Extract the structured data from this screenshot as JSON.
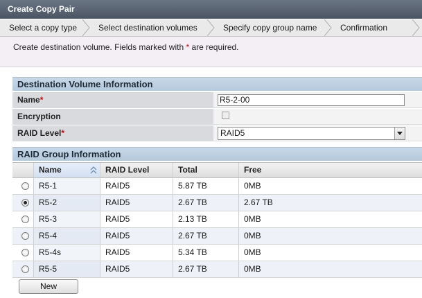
{
  "window": {
    "title": "Create Copy Pair"
  },
  "wizard": {
    "steps": [
      {
        "label": "Select a copy type"
      },
      {
        "label": "Select destination volumes"
      },
      {
        "label": "Specify copy group name"
      },
      {
        "label": "Confirmation"
      }
    ]
  },
  "info": {
    "text_before": "Create destination volume. Fields marked with ",
    "asterisk": "*",
    "text_after": " are required."
  },
  "volume_section": {
    "title": "Destination Volume Information",
    "name_label": "Name",
    "name_required": "*",
    "name_value": "R5-2-00",
    "encryption_label": "Encryption",
    "encryption_checked": false,
    "raid_label": "RAID Level",
    "raid_required": "*",
    "raid_value": "RAID5"
  },
  "raid_section": {
    "title": "RAID Group Information",
    "columns": [
      "Name",
      "RAID Level",
      "Total",
      "Free"
    ],
    "rows": [
      {
        "name": "R5-1",
        "raid": "RAID5",
        "total": "5.87 TB",
        "free": "0MB",
        "selected": false
      },
      {
        "name": "R5-2",
        "raid": "RAID5",
        "total": "2.67 TB",
        "free": "2.67 TB",
        "selected": true
      },
      {
        "name": "R5-3",
        "raid": "RAID5",
        "total": "2.13 TB",
        "free": "0MB",
        "selected": false
      },
      {
        "name": "R5-4",
        "raid": "RAID5",
        "total": "2.67 TB",
        "free": "0MB",
        "selected": false
      },
      {
        "name": "R5-4s",
        "raid": "RAID5",
        "total": "5.34 TB",
        "free": "0MB",
        "selected": false
      },
      {
        "name": "R5-5",
        "raid": "RAID5",
        "total": "2.67 TB",
        "free": "0MB",
        "selected": false
      }
    ]
  },
  "actions": {
    "new_label": "New"
  },
  "icons": {
    "sort": "sort-asc-icon",
    "dropdown": "chevron-down-icon",
    "step_separator": "chevron-right-icon"
  },
  "colors": {
    "titlebar": "#4a5463",
    "section_header": "#b5c9dc",
    "required": "#d40000",
    "info_band": "#f4eef5"
  }
}
